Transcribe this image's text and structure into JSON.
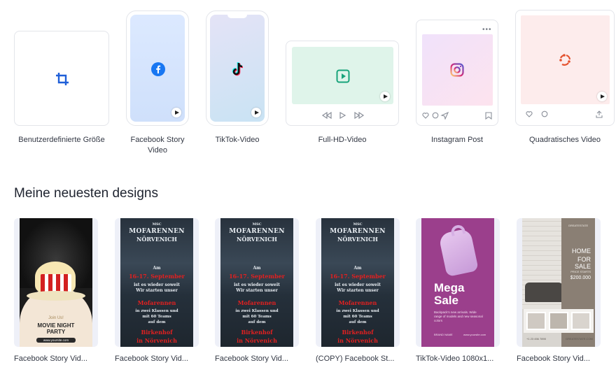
{
  "templates": [
    {
      "label": "Benutzerdefinierte Größe",
      "icon": "crop-icon"
    },
    {
      "label": "Facebook Story Video",
      "icon": "facebook-icon"
    },
    {
      "label": "TikTok-Video",
      "icon": "tiktok-icon"
    },
    {
      "label": "Full-HD-Video",
      "icon": "video-play-icon"
    },
    {
      "label": "Instagram Post",
      "icon": "instagram-icon"
    },
    {
      "label": "Quadratisches Video",
      "icon": "square-video-icon"
    }
  ],
  "recent_heading": "Meine neuesten designs",
  "designs": [
    {
      "label": "Facebook Story Vid...",
      "poster": {
        "small_text": "Join Us!",
        "title": "MOVIE NIGHT PARTY",
        "url": "www.yoursite.com"
      }
    },
    {
      "label": "Facebook Story Vid...",
      "poster": {
        "club": "MSC",
        "title1": "MOFARENNEN",
        "title2": "NÖRVENICH",
        "am": "Am",
        "date": "16-17. September",
        "line1": "ist es wieder soweit",
        "line2": "Wir starten unser",
        "event": "Mofarennen",
        "line3": "in zwei Klassen und",
        "line4": "mit 60 Teams",
        "line5": "auf dem",
        "venue1": "Birkenhof",
        "venue2": "in Nörvenich"
      }
    },
    {
      "label": "Facebook Story Vid...",
      "poster": {
        "club": "MSC",
        "title1": "MOFARENNEN",
        "title2": "NÖRVENICH",
        "am": "Am",
        "date": "16-17. September",
        "line1": "ist es wieder soweit",
        "line2": "Wir starten unser",
        "event": "Mofarennen",
        "line3": "in zwei Klassen und",
        "line4": "mit 60 Teams",
        "line5": "auf dem",
        "venue1": "Birkenhof",
        "venue2": "in Nörvenich"
      }
    },
    {
      "label": "(COPY) Facebook St...",
      "poster": {
        "club": "MSC",
        "title1": "MOFARENNEN",
        "title2": "NÖRVENICH",
        "am": "Am",
        "date": "16-17. September",
        "line1": "ist es wieder soweit",
        "line2": "Wir starten unser",
        "event": "Mofarennen",
        "line3": "in zwei Klassen und",
        "line4": "mit 60 Teams",
        "line5": "auf dem",
        "venue1": "Birkenhof",
        "venue2": "in Nörvenich"
      }
    },
    {
      "label": "TikTok-Video 1080x1...",
      "poster": {
        "title1": "Mega",
        "title2": "Sale",
        "body": "Backpack's new arrivals. Wide range of models and new seasonal colors",
        "brand": "BRAND NAME",
        "url": "www.yoursite.com"
      }
    },
    {
      "label": "Facebook Story Vid...",
      "poster": {
        "brand": "GREATESTATE",
        "title1": "HOME",
        "title2": "FOR SALE",
        "price_label": "PRICE STARTS",
        "price": "$200.000",
        "phone": "+1 23 456 7890",
        "site": "GREATESTATE.COM"
      }
    }
  ],
  "colors": {
    "accent_blue": "#1f5fd8",
    "facebook": "#1877f2",
    "insta_pink": "#d6249f",
    "teal": "#17a37a",
    "square_red": "#e4512d"
  }
}
